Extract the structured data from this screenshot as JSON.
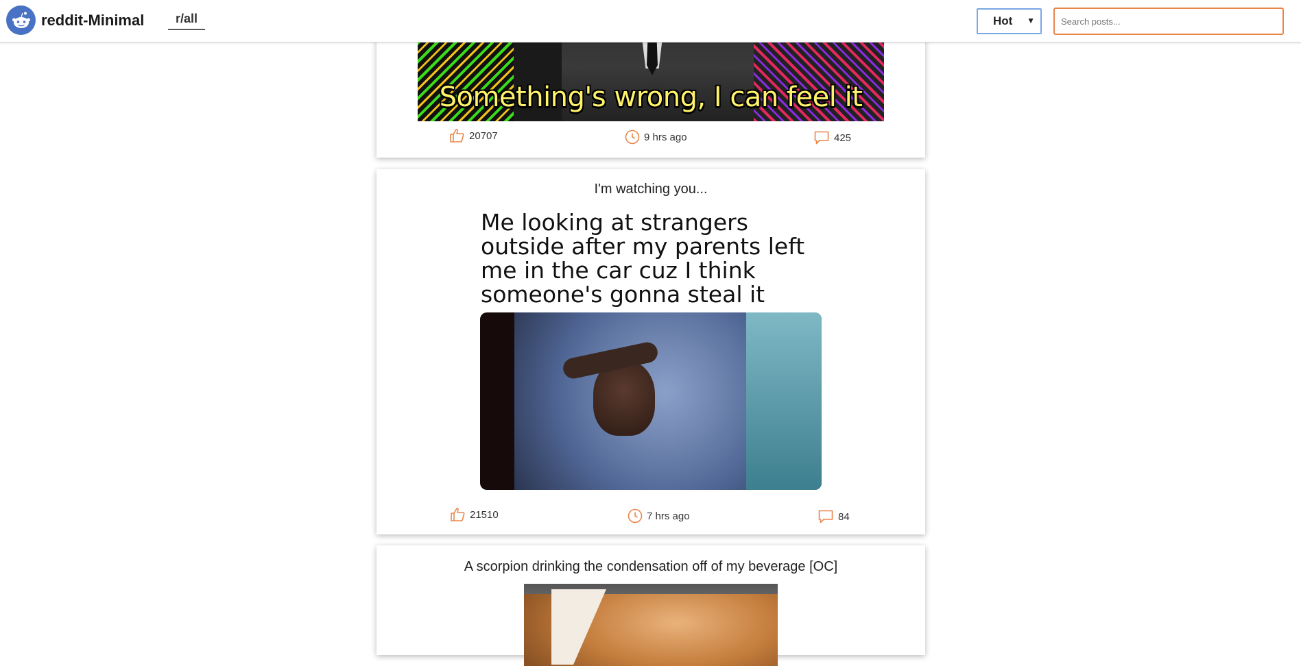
{
  "header": {
    "brand": "reddit-Minimal",
    "subreddit": "r/all",
    "sort_selected": "Hot",
    "search_placeholder": "Search posts..."
  },
  "posts": [
    {
      "title": "",
      "image_caption": "Something's wrong, I can feel it",
      "upvotes": "20707",
      "time": "9 hrs ago",
      "comments": "425"
    },
    {
      "title": "I'm watching you...",
      "image_caption": "Me looking at strangers outside after my parents left me in the car cuz I think someone's gonna steal it",
      "upvotes": "21510",
      "time": "7 hrs ago",
      "comments": "84"
    },
    {
      "title": "A scorpion drinking the condensation off of my beverage [OC]"
    }
  ],
  "colors": {
    "accent": "#e8864a",
    "logo": "#4a72c4",
    "select_border": "#7aa7e6"
  }
}
